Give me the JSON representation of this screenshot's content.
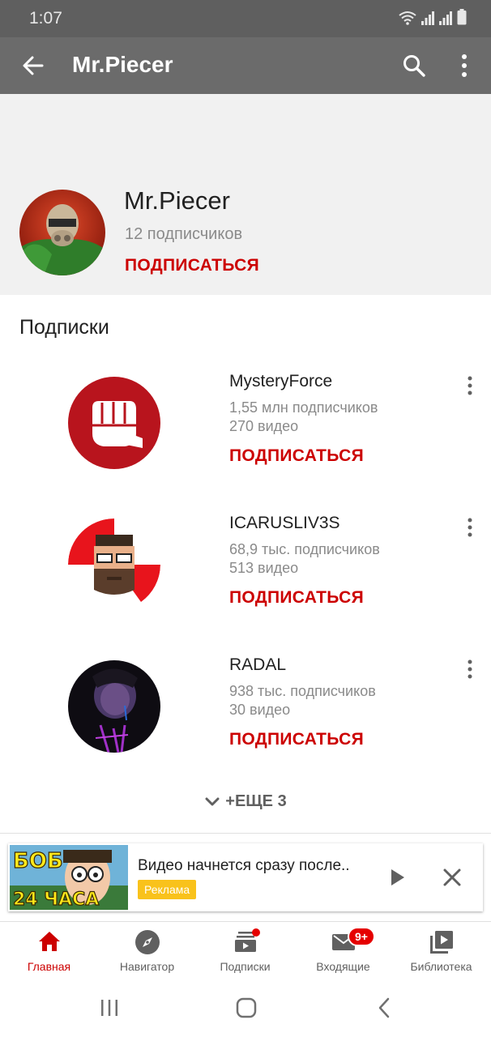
{
  "status_bar": {
    "time": "1:07"
  },
  "app_bar": {
    "title": "Mr.Piecer"
  },
  "channel": {
    "name": "Mr.Piecer",
    "subscribers": "12 подписчиков",
    "subscribe_label": "ПОДПИСАТЬСЯ"
  },
  "section_title": "Подписки",
  "subscriptions": [
    {
      "name": "MysteryForce",
      "subscribers": "1,55 млн подписчиков",
      "videos": "270 видео",
      "button": "ПОДПИСАТЬСЯ"
    },
    {
      "name": "ICARUSLIV3S",
      "subscribers": "68,9 тыс. подписчиков",
      "videos": "513 видео",
      "button": "ПОДПИСАТЬСЯ"
    },
    {
      "name": "RADAL",
      "subscribers": "938 тыс. подписчиков",
      "videos": "30 видео",
      "button": "ПОДПИСАТЬСЯ"
    }
  ],
  "more_label": "+ЕЩЕ 3",
  "ad": {
    "title": "Видео начнется сразу после..",
    "badge": "Реклама",
    "thumb_text_top": "БОБ",
    "thumb_text_bottom": "24 ЧАСА"
  },
  "bottom_nav": [
    {
      "label": "Главная",
      "icon": "home-icon",
      "active": true
    },
    {
      "label": "Навигатор",
      "icon": "compass-icon",
      "active": false
    },
    {
      "label": "Подписки",
      "icon": "subscriptions-icon",
      "active": false
    },
    {
      "label": "Входящие",
      "icon": "inbox-icon",
      "active": false,
      "badge": "9+"
    },
    {
      "label": "Библиотека",
      "icon": "library-icon",
      "active": false
    }
  ],
  "colors": {
    "accent": "#cc0000",
    "appbar": "#6b6b6b",
    "statusbar": "#5f5f5f",
    "header_bg": "#f1f1f1"
  }
}
